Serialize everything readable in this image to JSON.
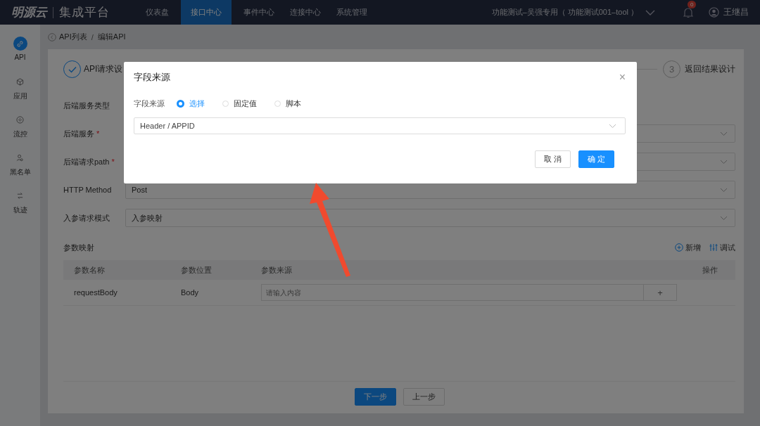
{
  "top_bar": {
    "logo": "明源云",
    "product": "集成平台",
    "nav": [
      {
        "label": "仪表盘",
        "selected": false
      },
      {
        "label": "接口中心",
        "selected": true
      },
      {
        "label": "事件中心",
        "selected": false
      },
      {
        "label": "连接中心",
        "selected": false
      },
      {
        "label": "系统管理",
        "selected": false
      }
    ],
    "tenant": "功能测试–吴强专用（ 功能测试001–tool ）",
    "notification_count": "0",
    "user": "王继昌"
  },
  "sidebar": {
    "items": [
      {
        "label": "API",
        "kind": "api",
        "selected": true
      },
      {
        "label": "应用",
        "kind": "app",
        "selected": false
      },
      {
        "label": "流控",
        "kind": "flow",
        "selected": false
      },
      {
        "label": "黑名单",
        "kind": "blacklist",
        "selected": false
      },
      {
        "label": "轨迹",
        "kind": "trace",
        "selected": false
      }
    ]
  },
  "breadcrumb": {
    "items": [
      "API列表",
      "编辑API"
    ],
    "separator": "/"
  },
  "steps": [
    {
      "label": "API请求设",
      "done": true
    },
    {
      "number": "3",
      "label": "返回结果设计",
      "done": false
    }
  ],
  "form": {
    "rows": [
      {
        "label": "后端服务类型",
        "kind": "plain"
      },
      {
        "label": "后端服务",
        "required_mark": "*",
        "kind": "select"
      },
      {
        "label": "后端请求path",
        "required_mark": "*",
        "kind": "select"
      },
      {
        "label": "HTTP Method",
        "kind": "select",
        "value": "Post"
      },
      {
        "label": "入参请求模式",
        "kind": "select",
        "value": "入参映射"
      }
    ]
  },
  "params": {
    "title": "参数映射",
    "actions": [
      {
        "label": "新增",
        "kind": "add"
      },
      {
        "label": "调试",
        "kind": "debug"
      }
    ],
    "columns": [
      "参数名称",
      "参数位置",
      "参数来源",
      "操作"
    ],
    "rows": [
      {
        "name": "requestBody",
        "location": "Body",
        "source_placeholder": "请输入内容",
        "add_button": "+"
      }
    ]
  },
  "footer": {
    "buttons": [
      {
        "label": "下一步",
        "primary": true
      },
      {
        "label": "上一步",
        "primary": false
      }
    ]
  },
  "dialog": {
    "title": "字段来源",
    "close": "×",
    "field_label": "字段来源",
    "options": [
      {
        "label": "选择",
        "selected": true
      },
      {
        "label": "固定值",
        "selected": false
      },
      {
        "label": "脚本",
        "selected": false
      }
    ],
    "select_value": "Header / APPID",
    "buttons": [
      {
        "label": "取 消",
        "primary": false
      },
      {
        "label": "确 定",
        "primary": true
      }
    ]
  }
}
